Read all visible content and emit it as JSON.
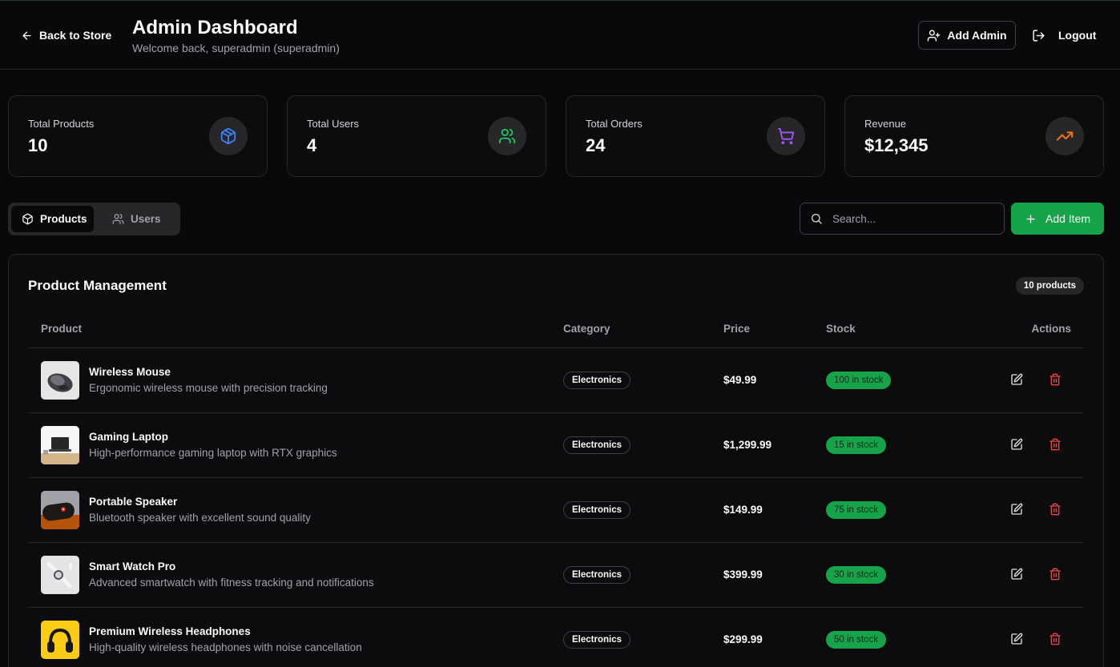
{
  "header": {
    "back_label": "Back to Store",
    "title": "Admin Dashboard",
    "welcome": "Welcome back, superadmin (superadmin)",
    "add_admin_label": "Add Admin",
    "logout_label": "Logout"
  },
  "stats": [
    {
      "label": "Total Products",
      "value": "10",
      "icon": "package-icon",
      "color": "#3b82f6"
    },
    {
      "label": "Total Users",
      "value": "4",
      "icon": "users-icon",
      "color": "#22c55e"
    },
    {
      "label": "Total Orders",
      "value": "24",
      "icon": "cart-icon",
      "color": "#a855f7"
    },
    {
      "label": "Revenue",
      "value": "$12,345",
      "icon": "trending-up-icon",
      "color": "#f97316"
    }
  ],
  "tabs": [
    {
      "label": "Products",
      "active": true
    },
    {
      "label": "Users",
      "active": false
    }
  ],
  "search": {
    "placeholder": "Search...",
    "value": ""
  },
  "add_item_label": "Add Item",
  "panel": {
    "title": "Product Management",
    "count": "10 products",
    "columns": [
      "Product",
      "Category",
      "Price",
      "Stock",
      "Actions"
    ]
  },
  "products": [
    {
      "name": "Wireless Mouse",
      "desc": "Ergonomic wireless mouse with precision tracking",
      "category": "Electronics",
      "price": "$49.99",
      "stock": "100 in stock"
    },
    {
      "name": "Gaming Laptop",
      "desc": "High-performance gaming laptop with RTX graphics",
      "category": "Electronics",
      "price": "$1,299.99",
      "stock": "15 in stock"
    },
    {
      "name": "Portable Speaker",
      "desc": "Bluetooth speaker with excellent sound quality",
      "category": "Electronics",
      "price": "$149.99",
      "stock": "75 in stock"
    },
    {
      "name": "Smart Watch Pro",
      "desc": "Advanced smartwatch with fitness tracking and notifications",
      "category": "Electronics",
      "price": "$399.99",
      "stock": "30 in stock"
    },
    {
      "name": "Premium Wireless Headphones",
      "desc": "High-quality wireless headphones with noise cancellation",
      "category": "Electronics",
      "price": "$299.99",
      "stock": "50 in stock"
    }
  ],
  "colors": {
    "accent_green": "#16a34a",
    "danger_red": "#ef4444",
    "background": "#09090b",
    "border": "#27272a"
  }
}
